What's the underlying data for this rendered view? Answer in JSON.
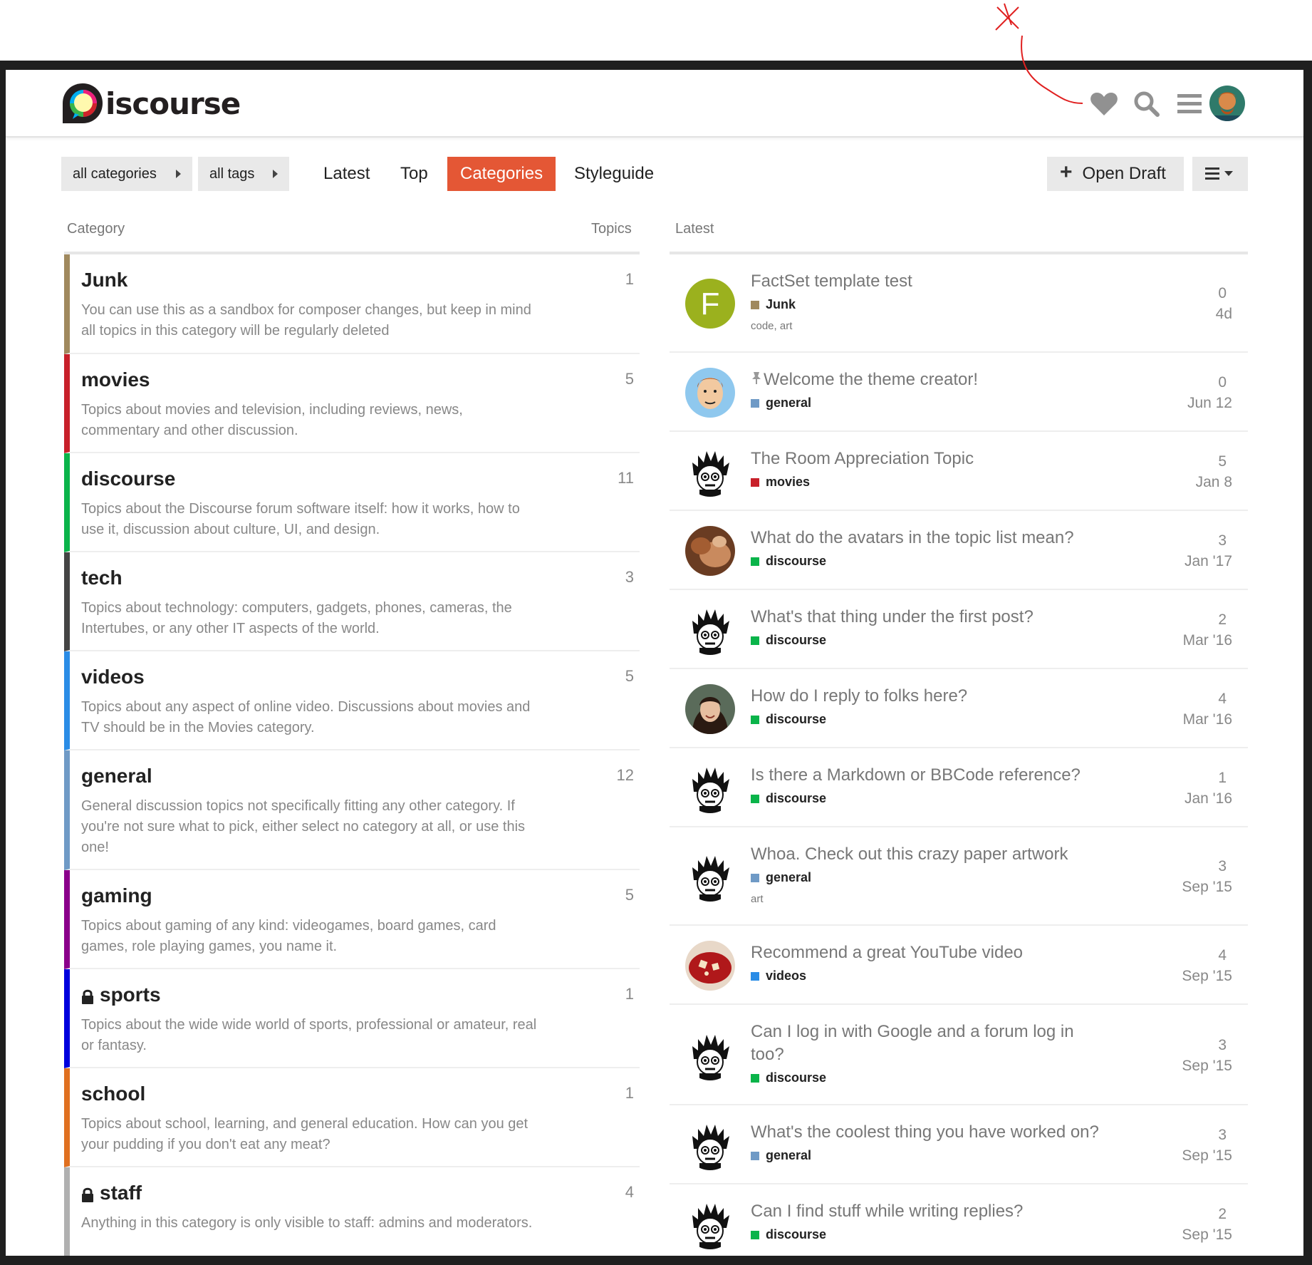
{
  "header": {
    "logo_text": "iscourse",
    "icons": [
      "heart-icon",
      "search-icon",
      "hamburger-icon"
    ],
    "avatar": "user-avatar"
  },
  "nav": {
    "all_categories": "all categories",
    "all_tags": "all tags",
    "links": [
      "Latest",
      "Top",
      "Categories",
      "Styleguide"
    ],
    "active": "Categories",
    "open_draft": "Open Draft",
    "accent_color": "#e45735"
  },
  "columns": {
    "category": "Category",
    "topics": "Topics",
    "latest": "Latest"
  },
  "categories": [
    {
      "name": "Junk",
      "count": "1",
      "color": "#a0895e",
      "locked": false,
      "desc": "You can use this as a sandbox for composer changes, but keep in mind all topics in this category will be regularly deleted"
    },
    {
      "name": "movies",
      "count": "5",
      "color": "#c8202a",
      "locked": false,
      "desc": "Topics about movies and television, including reviews, news, commentary and other discussion."
    },
    {
      "name": "discourse",
      "count": "11",
      "color": "#0ab44a",
      "locked": false,
      "desc": "Topics about the Discourse forum software itself: how it works, how to use it, discussion about culture, UI, and design."
    },
    {
      "name": "tech",
      "count": "3",
      "color": "#444444",
      "locked": false,
      "desc": "Topics about technology: computers, gadgets, phones, cameras, the Intertubes, or any other IT aspects of the world."
    },
    {
      "name": "videos",
      "count": "5",
      "color": "#2a8ce6",
      "locked": false,
      "desc": "Topics about any aspect of online video. Discussions about movies and TV should be in the Movies category."
    },
    {
      "name": "general",
      "count": "12",
      "color": "#6f9ac6",
      "locked": false,
      "desc": "General discussion topics not specifically fitting any other category. If you're not sure what to pick, either select no category at all, or use this one!"
    },
    {
      "name": "gaming",
      "count": "5",
      "color": "#8b008b",
      "locked": false,
      "desc": "Topics about gaming of any kind: videogames, board games, card games, role playing games, you name it."
    },
    {
      "name": "sports",
      "count": "1",
      "color": "#0000dd",
      "locked": true,
      "desc": "Topics about the wide wide world of sports, professional or amateur, real or fantasy."
    },
    {
      "name": "school",
      "count": "1",
      "color": "#e07020",
      "locked": false,
      "desc": "Topics about school, learning, and general education. How can you get your pudding if you don't eat any meat?"
    },
    {
      "name": "staff",
      "count": "4",
      "color": "#b0b0b0",
      "locked": true,
      "desc": "Anything in this category is only visible to staff: admins and moderators."
    }
  ],
  "latest": [
    {
      "title": "FactSet template test",
      "category": "Junk",
      "cat_color": "#a0895e",
      "tags": "code, art",
      "posts": "0",
      "date": "4d",
      "avatar": "letter-f",
      "pinned": false
    },
    {
      "title": "Welcome the theme creator!",
      "category": "general",
      "cat_color": "#6f9ac6",
      "tags": "",
      "posts": "0",
      "date": "Jun 12",
      "avatar": "cartoon-face",
      "pinned": true
    },
    {
      "title": "The Room Appreciation Topic",
      "category": "movies",
      "cat_color": "#c8202a",
      "tags": "",
      "posts": "5",
      "date": "Jan 8",
      "avatar": "spiky",
      "pinned": false
    },
    {
      "title": "What do the avatars in the topic list mean?",
      "category": "discourse",
      "cat_color": "#0ab44a",
      "tags": "",
      "posts": "3",
      "date": "Jan '17",
      "avatar": "photo-brown",
      "pinned": false
    },
    {
      "title": "What's that thing under the first post?",
      "category": "discourse",
      "cat_color": "#0ab44a",
      "tags": "",
      "posts": "2",
      "date": "Mar '16",
      "avatar": "spiky",
      "pinned": false
    },
    {
      "title": "How do I reply to folks here?",
      "category": "discourse",
      "cat_color": "#0ab44a",
      "tags": "",
      "posts": "4",
      "date": "Mar '16",
      "avatar": "photo-woman",
      "pinned": false
    },
    {
      "title": "Is there a Markdown or BBCode reference?",
      "category": "discourse",
      "cat_color": "#0ab44a",
      "tags": "",
      "posts": "1",
      "date": "Jan '16",
      "avatar": "spiky",
      "pinned": false
    },
    {
      "title": "Whoa. Check out this crazy paper artwork",
      "category": "general",
      "cat_color": "#6f9ac6",
      "tags": "art",
      "posts": "3",
      "date": "Sep '15",
      "avatar": "spiky",
      "pinned": false
    },
    {
      "title": "Recommend a great YouTube video",
      "category": "videos",
      "cat_color": "#2a8ce6",
      "tags": "",
      "posts": "4",
      "date": "Sep '15",
      "avatar": "photo-red",
      "pinned": false
    },
    {
      "title": "Can I log in with Google and a forum log in too?",
      "category": "discourse",
      "cat_color": "#0ab44a",
      "tags": "",
      "posts": "3",
      "date": "Sep '15",
      "avatar": "spiky",
      "pinned": false
    },
    {
      "title": "What's the coolest thing you have worked on?",
      "category": "general",
      "cat_color": "#6f9ac6",
      "tags": "",
      "posts": "3",
      "date": "Sep '15",
      "avatar": "spiky",
      "pinned": false
    },
    {
      "title": "Can I find stuff while writing replies?",
      "category": "discourse",
      "cat_color": "#0ab44a",
      "tags": "",
      "posts": "2",
      "date": "Sep '15",
      "avatar": "spiky",
      "pinned": false
    }
  ]
}
